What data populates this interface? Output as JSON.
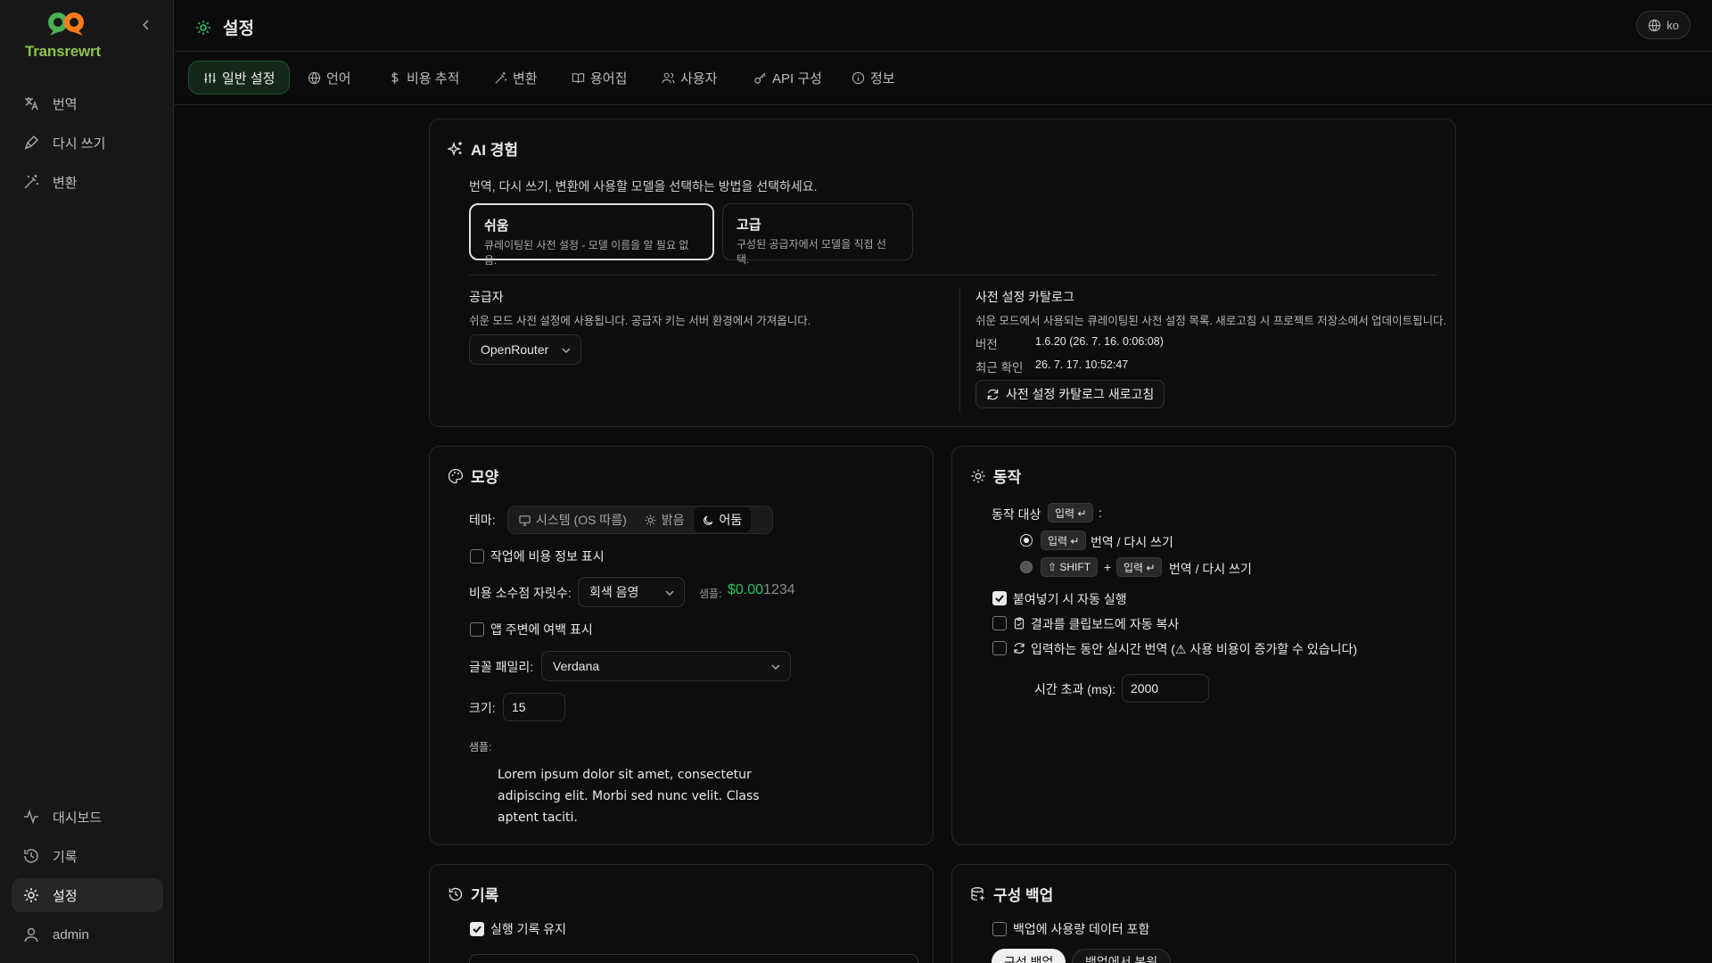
{
  "app": {
    "name": "Transrewrt"
  },
  "sidebar": {
    "top_items": [
      {
        "label": "번역",
        "icon": "translate-icon"
      },
      {
        "label": "다시 쓰기",
        "icon": "pen-icon"
      },
      {
        "label": "변환",
        "icon": "wand-icon"
      }
    ],
    "bottom_items": [
      {
        "label": "대시보드",
        "icon": "activity-icon"
      },
      {
        "label": "기록",
        "icon": "history-icon"
      },
      {
        "label": "설정",
        "icon": "gear-icon"
      },
      {
        "label": "admin",
        "icon": "user-icon"
      }
    ]
  },
  "header": {
    "title": "설정",
    "language": "ko"
  },
  "tabs": [
    {
      "label": "일반 설정",
      "icon": "sliders-icon"
    },
    {
      "label": "언어",
      "icon": "globe-icon"
    },
    {
      "label": "비용 추적",
      "icon": "dollar-icon"
    },
    {
      "label": "변환",
      "icon": "wand-icon"
    },
    {
      "label": "용어집",
      "icon": "book-icon"
    },
    {
      "label": "사용자",
      "icon": "users-icon"
    },
    {
      "label": "API 구성",
      "icon": "key-icon"
    },
    {
      "label": "정보",
      "icon": "info-icon"
    }
  ],
  "ai": {
    "title": "AI 경험",
    "description": "번역, 다시 쓰기, 변환에 사용할 모델을 선택하는 방법을 선택하세요.",
    "modes": [
      {
        "title": "쉬움",
        "desc": "큐레이팅된 사전 설정 - 모델 이름을 알 필요 없음."
      },
      {
        "title": "고급",
        "desc": "구성된 공급자에서 모델을 직접 선택."
      }
    ],
    "provider": {
      "label": "공급자",
      "desc": "쉬운 모드 사전 설정에 사용됩니다. 공급자 키는 서버 환경에서 가져옵니다.",
      "value": "OpenRouter"
    },
    "catalog": {
      "label": "사전 설정 카탈로그",
      "desc": "쉬운 모드에서 사용되는 큐레이팅된 사전 설정 목록. 새로고침 시 프로젝트 저장소에서 업데이트됩니다.",
      "version_label": "버전",
      "version_value": "1.6.20 (26. 7. 16. 0:06:08)",
      "checked_label": "최근 확인",
      "checked_value": "26. 7. 17. 10:52:47",
      "refresh_label": "사전 설정 카탈로그 새로고침"
    }
  },
  "appearance": {
    "title": "모양",
    "theme_label": "테마:",
    "theme_options": [
      "시스템 (OS 따름)",
      "밝음",
      "어둠"
    ],
    "show_cost_label": "작업에 비용 정보 표시",
    "decimals_label": "비용 소수점 자릿수:",
    "decimals_value": "회색 음영",
    "sample_label": "샘플:",
    "sample_bright": "$0.00",
    "sample_dim": "1234",
    "margin_label": "앱 주변에 여백 표시",
    "font_family_label": "글꼴 패밀리:",
    "font_family_value": "Verdana",
    "size_label": "크기:",
    "size_value": "15",
    "preview_label": "샘플:",
    "preview_text": "Lorem ipsum dolor sit amet, consectetur adipiscing elit. Morbi sed nunc velit. Class aptent taciti."
  },
  "behavior": {
    "title": "동작",
    "trigger_label": "동작 대상",
    "trigger_key": "입력 ↵",
    "trigger_colon": ":",
    "option1_key": "입력 ↵",
    "option1_label": "번역 / 다시 쓰기",
    "option2_key1": "⇧ SHIFT",
    "option2_plus": "+",
    "option2_key2": "입력 ↵",
    "option2_label": "번역 / 다시 쓰기",
    "autorun_label": "붙여넣기 시 자동 실행",
    "autocopy_label": "결과를 클립보드에 자동 복사",
    "realtime_label": "입력하는 동안 실시간 번역 (⚠ 사용 비용이 증가할 수 있습니다)",
    "timeout_label": "시간 초과 (ms):",
    "timeout_value": "2000"
  },
  "history": {
    "title": "기록",
    "keep_label": "실행 기록 유지"
  },
  "backup": {
    "title": "구성 백업",
    "include_usage_label": "백업에 사용량 데이터 포함",
    "backup_button": "구성 백업",
    "restore_button": "백업에서 복원"
  },
  "colors": {
    "accent": "#22c55e",
    "brand": "#8bc34a",
    "sample_green": "#22c55e"
  }
}
